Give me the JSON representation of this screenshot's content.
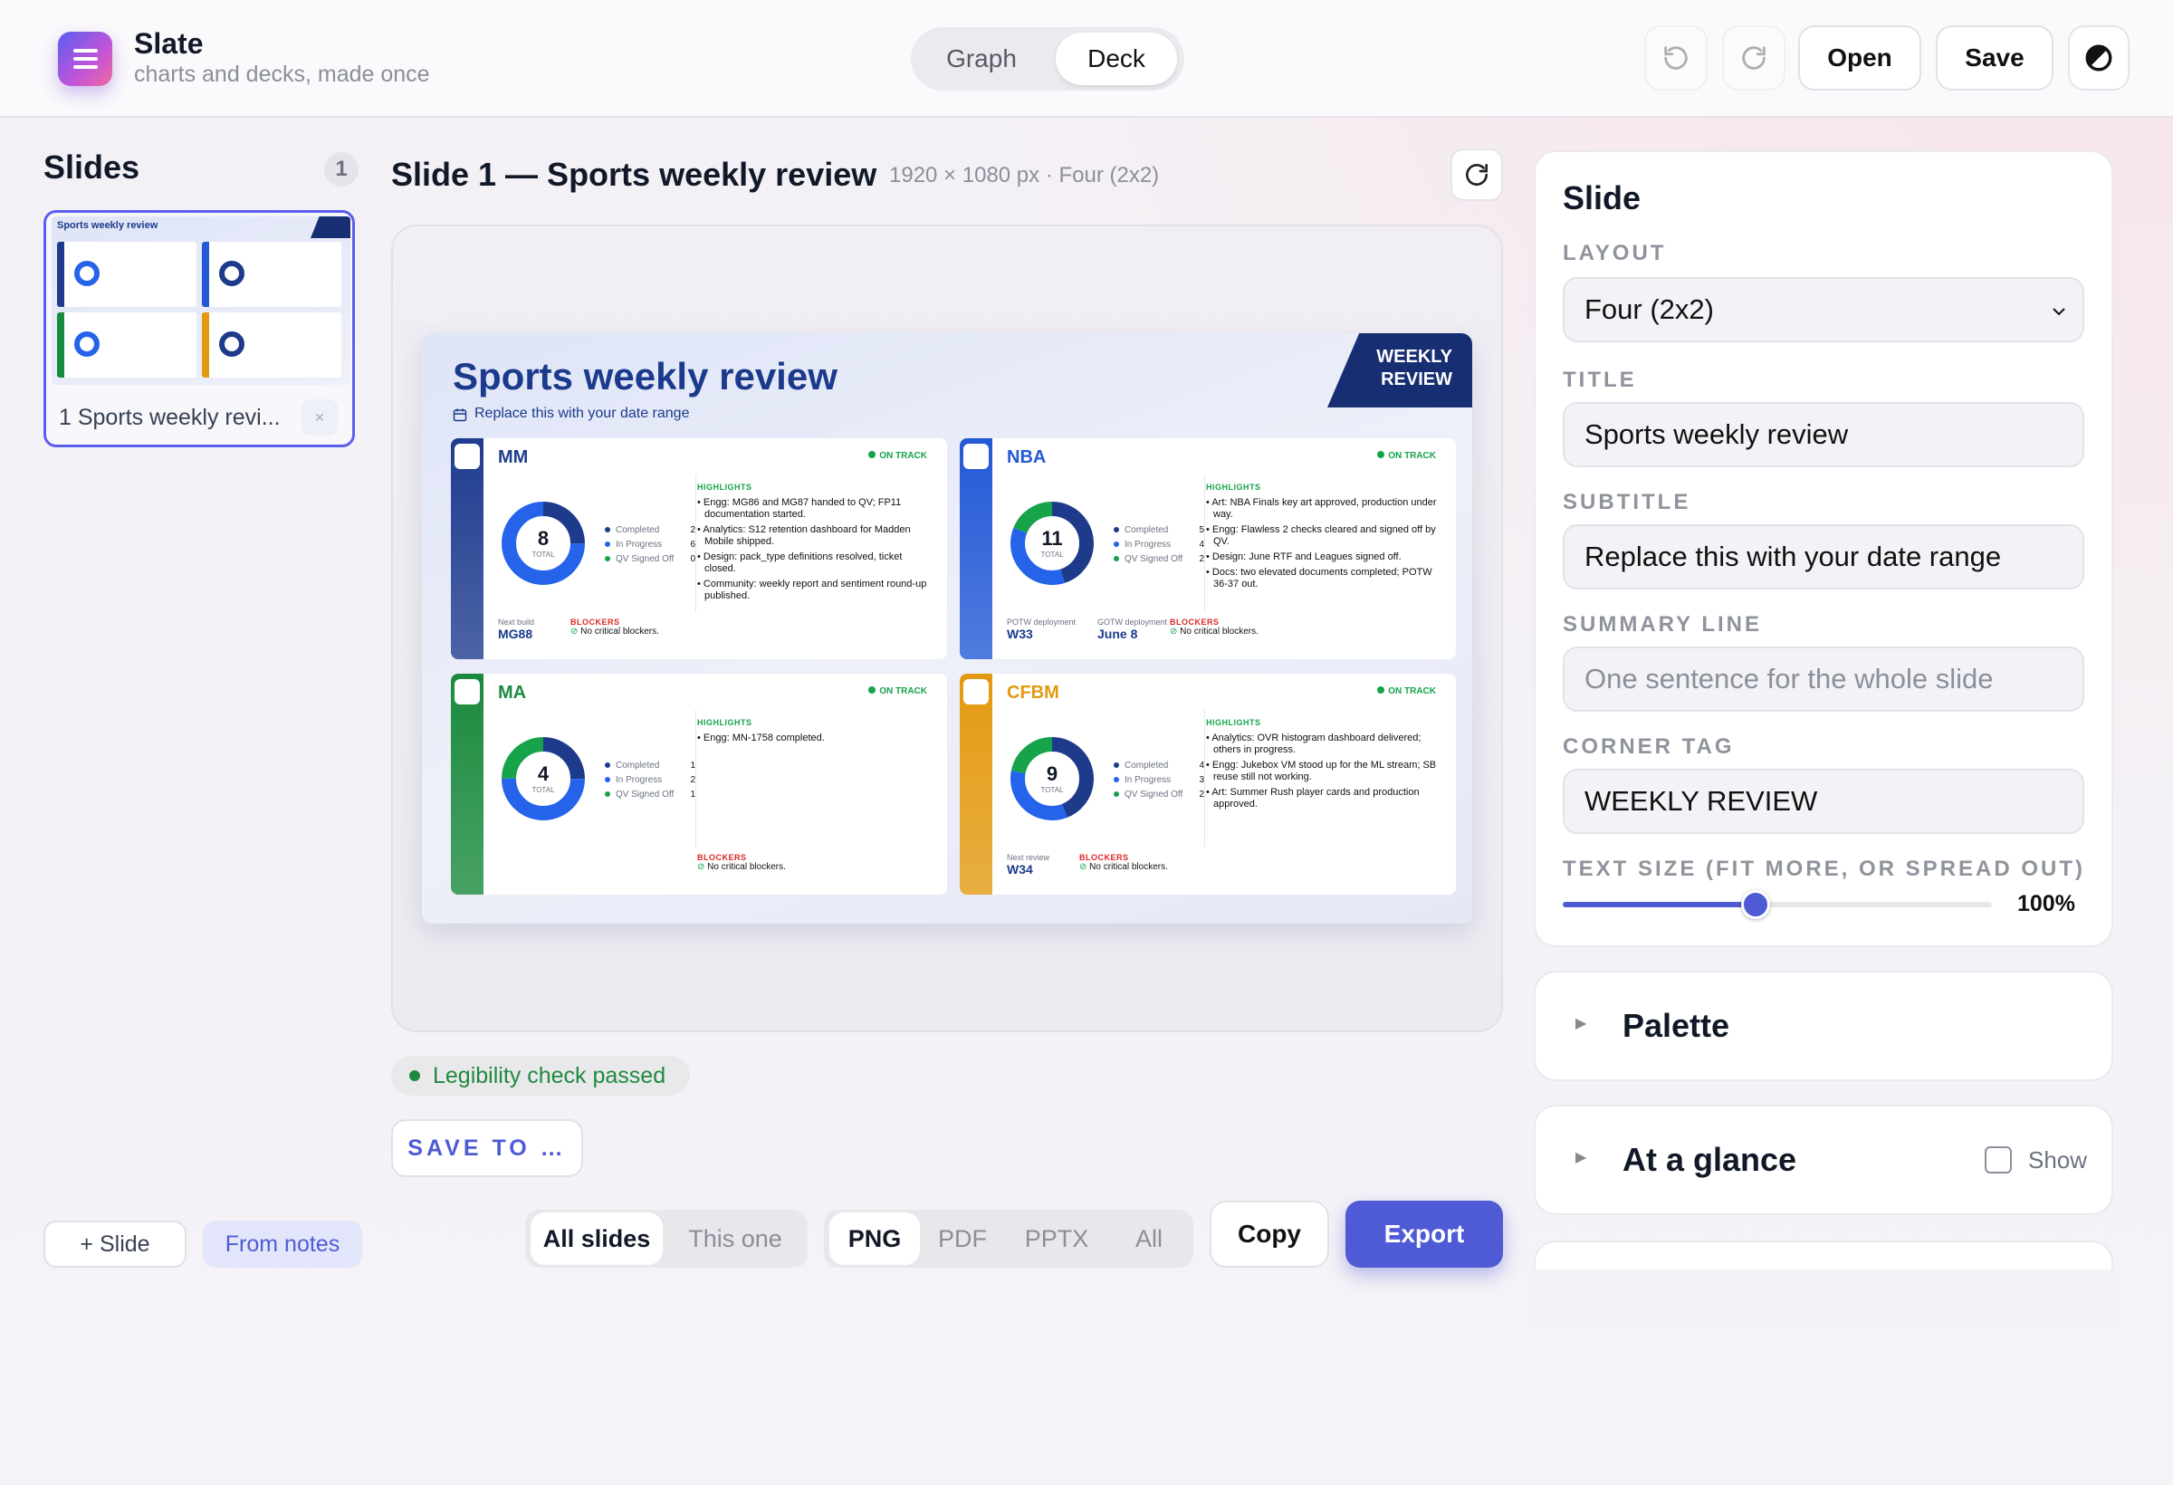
{
  "app": {
    "name": "Slate",
    "tagline": "charts and decks, made once"
  },
  "mode_tabs": [
    "Graph",
    "Deck"
  ],
  "toolbar": {
    "open": "Open",
    "save": "Save"
  },
  "sidebar": {
    "title": "Slides",
    "count": "1",
    "thumb_label": "1 Sports weekly revi...",
    "add_slide": "+ Slide",
    "from_notes": "From notes"
  },
  "main": {
    "heading": "Slide 1 — Sports weekly review",
    "meta": "1920 × 1080 px · Four (2x2)",
    "legibility": "Legibility check passed",
    "save_to": "SAVE TO …"
  },
  "export": {
    "scope": [
      "All slides",
      "This one"
    ],
    "formats": [
      "PNG",
      "PDF",
      "PPTX",
      "All"
    ],
    "copy": "Copy",
    "export": "Export"
  },
  "slide": {
    "title": "Sports weekly review",
    "subtitle": "Replace this with your date range",
    "tag": "WEEKLY REVIEW",
    "status": "ON TRACK",
    "highlights_label": "HIGHLIGHTS",
    "blockers_label": "BLOCKERS",
    "no_blockers": "No critical blockers.",
    "legend_labels": [
      "Completed",
      "In Progress",
      "QV Signed Off"
    ],
    "total_label": "TOTAL",
    "cards": [
      {
        "name": "MM",
        "color": "#1f3c8f",
        "total": "8",
        "counts": [
          "2",
          "6",
          "0"
        ],
        "fractions": [
          0.25,
          0.75,
          0
        ],
        "highlights": [
          "Engg: MG86 and MG87 handed to QV; FP11 documentation started.",
          "Analytics: S12 retention dashboard for Madden Mobile shipped.",
          "Design: pack_type definitions resolved, ticket closed.",
          "Community: weekly report and sentiment round-up published."
        ],
        "notes": [
          {
            "label": "Next build",
            "value": "MG88"
          }
        ]
      },
      {
        "name": "NBA",
        "color": "#2459d6",
        "total": "11",
        "counts": [
          "5",
          "4",
          "2"
        ],
        "fractions": [
          0.45,
          0.36,
          0.19
        ],
        "highlights": [
          "Art: NBA Finals key art approved, production under way.",
          "Engg: Flawless 2 checks cleared and signed off by QV.",
          "Design: June RTF and Leagues signed off.",
          "Docs: two elevated documents completed; POTW 36-37 out."
        ],
        "notes": [
          {
            "label": "POTW deployment",
            "value": "W33"
          },
          {
            "label": "GOTW deployment",
            "value": "June 8"
          }
        ]
      },
      {
        "name": "MA",
        "color": "#1a8a3e",
        "total": "4",
        "counts": [
          "1",
          "2",
          "1"
        ],
        "fractions": [
          0.25,
          0.5,
          0.25
        ],
        "highlights": [
          "Engg: MN-1758 completed."
        ],
        "notes": []
      },
      {
        "name": "CFBM",
        "color": "#e39a12",
        "total": "9",
        "counts": [
          "4",
          "3",
          "2"
        ],
        "fractions": [
          0.44,
          0.34,
          0.22
        ],
        "highlights": [
          "Analytics: OVR histogram dashboard delivered; others in progress.",
          "Engg: Jukebox VM stood up for the ML stream; SB reuse still not working.",
          "Art: Summer Rush player cards and production approved."
        ],
        "notes": [
          {
            "label": "Next review",
            "value": "W34"
          }
        ]
      }
    ]
  },
  "inspector": {
    "title": "Slide",
    "layout_label": "LAYOUT",
    "layout_value": "Four (2x2)",
    "title_label": "TITLE",
    "title_value": "Sports weekly review",
    "subtitle_label": "SUBTITLE",
    "subtitle_value": "Replace this with your date range",
    "summary_label": "SUMMARY LINE",
    "summary_placeholder": "One sentence for the whole slide",
    "corner_label": "CORNER TAG",
    "corner_value": "WEEKLY REVIEW",
    "textsize_label": "TEXT SIZE (FIT MORE, OR SPREAD OUT)",
    "textsize_value": "100%",
    "textsize_fraction": 0.45,
    "palette": "Palette",
    "glance": "At a glance",
    "show": "Show"
  },
  "colors": {
    "accent": "#4f5bd5",
    "completed": "#1e3a8a",
    "in_progress": "#2563eb",
    "signed_off": "#16a34a"
  }
}
